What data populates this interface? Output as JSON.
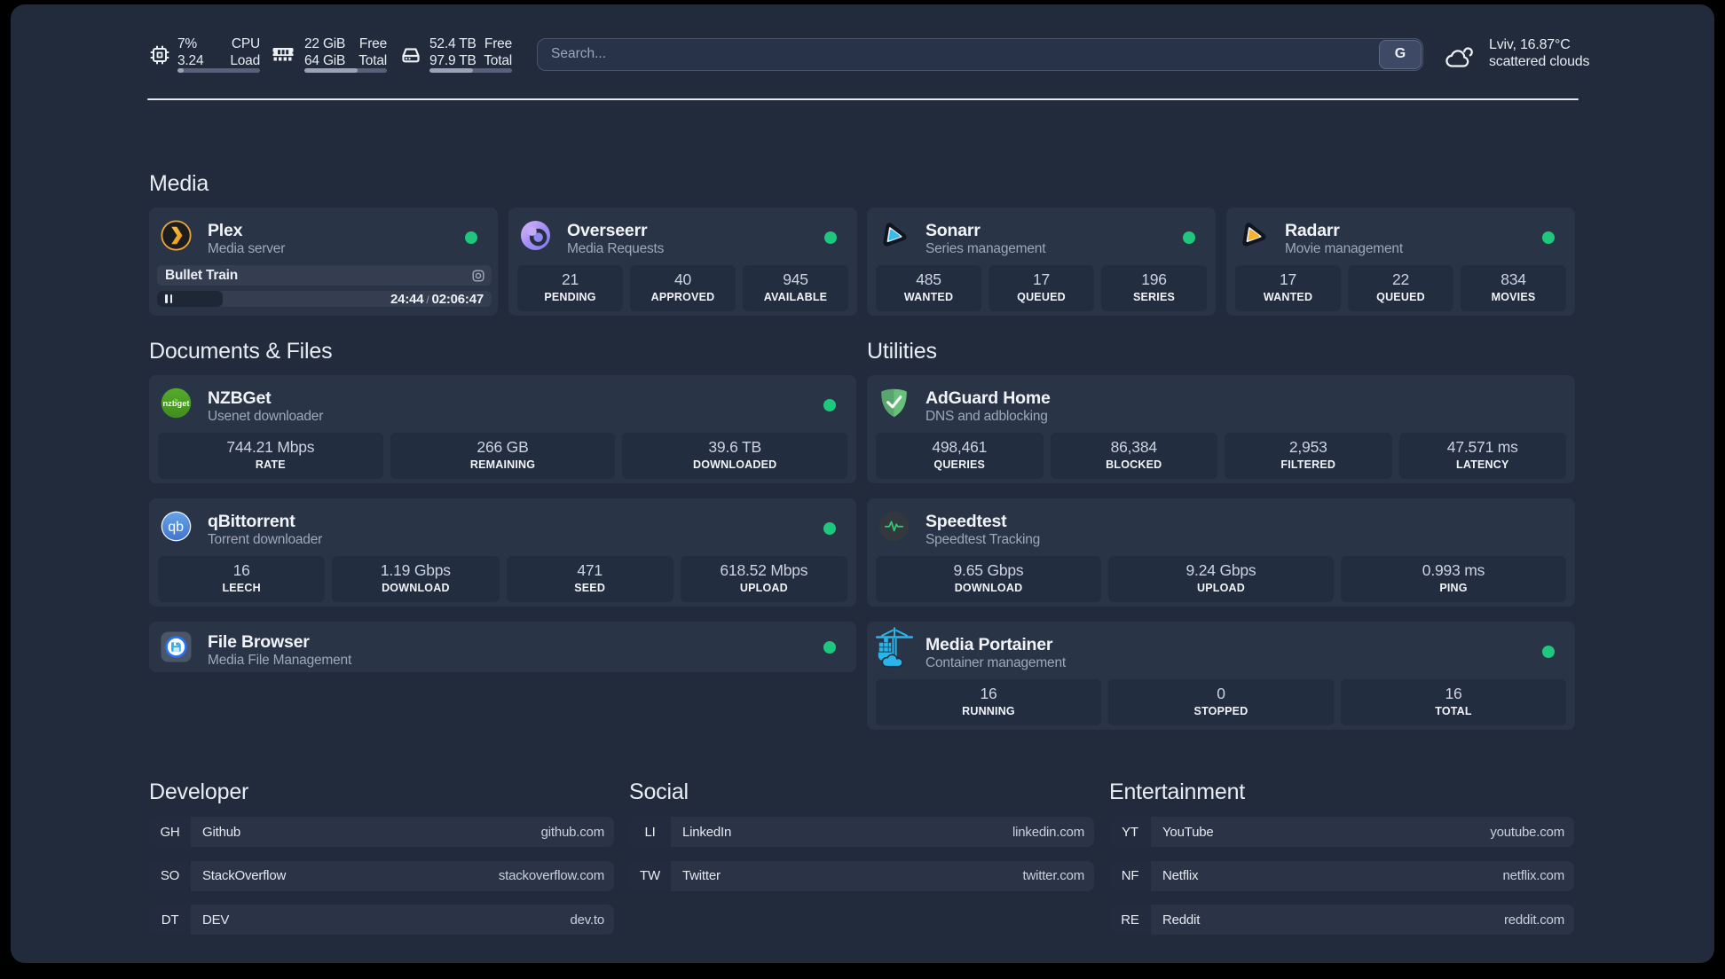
{
  "topbar": {
    "resources": [
      {
        "icon": "cpu-icon",
        "rows": [
          {
            "value": "7%",
            "label": "CPU"
          },
          {
            "value": "3.24",
            "label": "Load"
          }
        ],
        "progress_pct": 8
      },
      {
        "icon": "memory-icon",
        "rows": [
          {
            "value": "22 GiB",
            "label": "Free"
          },
          {
            "value": "64 GiB",
            "label": "Total"
          }
        ],
        "progress_pct": 64
      },
      {
        "icon": "disk-icon",
        "rows": [
          {
            "value": "52.4 TB",
            "label": "Free"
          },
          {
            "value": "97.9 TB",
            "label": "Total"
          }
        ],
        "progress_pct": 53
      }
    ],
    "search": {
      "placeholder": "Search...",
      "button_label": "G"
    },
    "weather": {
      "location_temp": "Lviv, 16.87°C",
      "condition": "scattered clouds"
    }
  },
  "groups": {
    "media": {
      "title": "Media",
      "services": [
        {
          "name": "Plex",
          "description": "Media server",
          "status_color": "#1fc77d",
          "player": {
            "title": "Bullet Train",
            "elapsed": "24:44",
            "separator": "/",
            "duration": "02:06:47",
            "progress_pct": 19.6
          }
        },
        {
          "name": "Overseerr",
          "description": "Media Requests",
          "stats": [
            {
              "value": "21",
              "label": "PENDING"
            },
            {
              "value": "40",
              "label": "APPROVED"
            },
            {
              "value": "945",
              "label": "AVAILABLE"
            }
          ]
        },
        {
          "name": "Sonarr",
          "description": "Series management",
          "stats": [
            {
              "value": "485",
              "label": "WANTED"
            },
            {
              "value": "17",
              "label": "QUEUED"
            },
            {
              "value": "196",
              "label": "SERIES"
            }
          ]
        },
        {
          "name": "Radarr",
          "description": "Movie management",
          "stats": [
            {
              "value": "17",
              "label": "WANTED"
            },
            {
              "value": "22",
              "label": "QUEUED"
            },
            {
              "value": "834",
              "label": "MOVIES"
            }
          ]
        }
      ]
    },
    "documents": {
      "title": "Documents & Files",
      "services": [
        {
          "name": "NZBGet",
          "description": "Usenet downloader",
          "stats": [
            {
              "value": "744.21 Mbps",
              "label": "RATE"
            },
            {
              "value": "266 GB",
              "label": "REMAINING"
            },
            {
              "value": "39.6 TB",
              "label": "DOWNLOADED"
            }
          ]
        },
        {
          "name": "qBittorrent",
          "description": "Torrent downloader",
          "stats": [
            {
              "value": "16",
              "label": "LEECH"
            },
            {
              "value": "1.19 Gbps",
              "label": "DOWNLOAD"
            },
            {
              "value": "471",
              "label": "SEED"
            },
            {
              "value": "618.52 Mbps",
              "label": "UPLOAD"
            }
          ]
        },
        {
          "name": "File Browser",
          "description": "Media File Management",
          "stats": []
        }
      ]
    },
    "utilities": {
      "title": "Utilities",
      "services": [
        {
          "name": "AdGuard Home",
          "description": "DNS and adblocking",
          "stats": [
            {
              "value": "498,461",
              "label": "QUERIES"
            },
            {
              "value": "86,384",
              "label": "BLOCKED"
            },
            {
              "value": "2,953",
              "label": "FILTERED"
            },
            {
              "value": "47.571 ms",
              "label": "LATENCY"
            }
          ]
        },
        {
          "name": "Speedtest",
          "description": "Speedtest Tracking",
          "stats": [
            {
              "value": "9.65 Gbps",
              "label": "DOWNLOAD"
            },
            {
              "value": "9.24 Gbps",
              "label": "UPLOAD"
            },
            {
              "value": "0.993 ms",
              "label": "PING"
            }
          ]
        },
        {
          "name": "Media Portainer",
          "description": "Container management",
          "stats": [
            {
              "value": "16",
              "label": "RUNNING"
            },
            {
              "value": "0",
              "label": "STOPPED"
            },
            {
              "value": "16",
              "label": "TOTAL"
            }
          ]
        }
      ]
    }
  },
  "bookmarks": [
    {
      "title": "Developer",
      "items": [
        {
          "abbr": "GH",
          "name": "Github",
          "url": "github.com"
        },
        {
          "abbr": "SO",
          "name": "StackOverflow",
          "url": "stackoverflow.com"
        },
        {
          "abbr": "DT",
          "name": "DEV",
          "url": "dev.to"
        }
      ]
    },
    {
      "title": "Social",
      "items": [
        {
          "abbr": "LI",
          "name": "LinkedIn",
          "url": "linkedin.com"
        },
        {
          "abbr": "TW",
          "name": "Twitter",
          "url": "twitter.com"
        }
      ]
    },
    {
      "title": "Entertainment",
      "items": [
        {
          "abbr": "YT",
          "name": "YouTube",
          "url": "youtube.com"
        },
        {
          "abbr": "NF",
          "name": "Netflix",
          "url": "netflix.com"
        },
        {
          "abbr": "RE",
          "name": "Reddit",
          "url": "reddit.com"
        }
      ]
    }
  ]
}
